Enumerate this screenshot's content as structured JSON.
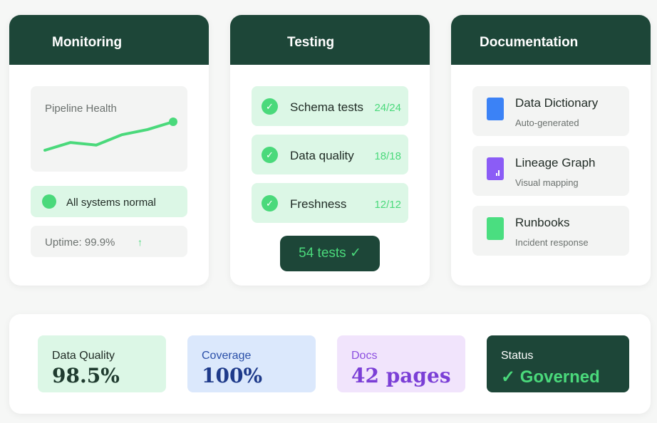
{
  "monitoring": {
    "title": "Monitoring",
    "chart_title": "Pipeline Health",
    "chart_data": {
      "type": "line",
      "title": "Pipeline Health",
      "values": [
        0,
        3,
        2,
        6,
        8,
        11
      ]
    },
    "status_text": "All systems normal",
    "uptime_text": "Uptime: 99.9%",
    "uptime_arrow": "↑",
    "accent": "#4ad97b"
  },
  "testing": {
    "title": "Testing",
    "tests": [
      {
        "name": "Schema tests",
        "count": "24/24",
        "check": "✓"
      },
      {
        "name": "Data quality",
        "count": "18/18",
        "check": "✓"
      },
      {
        "name": "Freshness",
        "count": "12/12",
        "check": "✓"
      }
    ],
    "summary": "54 tests ✓"
  },
  "documentation": {
    "title": "Documentation",
    "items": [
      {
        "title": "Data Dictionary",
        "subtitle": "Auto-generated",
        "icon": "blue-document-icon",
        "color": "#3b82f6"
      },
      {
        "title": "Lineage Graph",
        "subtitle": "Visual mapping",
        "icon": "purple-chart-document-icon",
        "color": "#8b5cf6"
      },
      {
        "title": "Runbooks",
        "subtitle": "Incident response",
        "icon": "green-document-icon",
        "color": "#4ade80"
      }
    ]
  },
  "metrics": [
    {
      "label": "Data Quality",
      "value": "98.5%"
    },
    {
      "label": "Coverage",
      "value": "100%"
    },
    {
      "label": "Docs",
      "value": "42 pages"
    },
    {
      "label": "Status",
      "value": "✓ Governed"
    }
  ]
}
